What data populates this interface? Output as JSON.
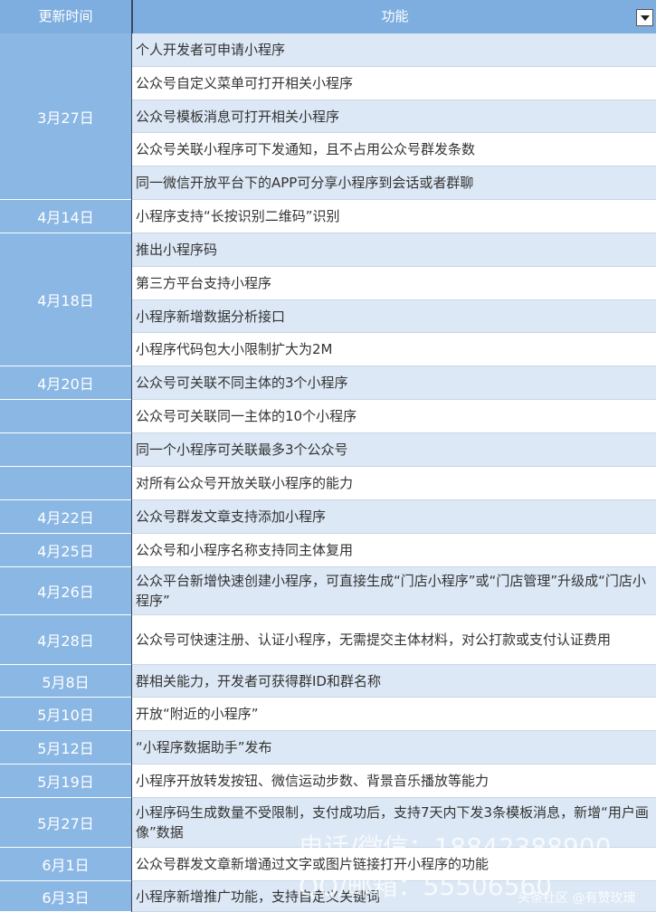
{
  "header": {
    "date_label": "更新时间",
    "function_label": "功能"
  },
  "dates": [
    {
      "label": "3月27日"
    },
    {
      "label": "4月14日"
    },
    {
      "label": "4月18日"
    },
    {
      "label": "4月20日"
    },
    {
      "label": ""
    },
    {
      "label": ""
    },
    {
      "label": ""
    },
    {
      "label": "4月22日"
    },
    {
      "label": "4月25日"
    },
    {
      "label": "4月26日"
    },
    {
      "label": "4月28日"
    },
    {
      "label": "5月8日"
    },
    {
      "label": "5月10日"
    },
    {
      "label": "5月12日"
    },
    {
      "label": "5月19日"
    },
    {
      "label": "5月27日"
    },
    {
      "label": "6月1日"
    },
    {
      "label": "6月3日"
    }
  ],
  "rows": [
    {
      "text": "个人开发者可申请小程序"
    },
    {
      "text": "公众号自定义菜单可打开相关小程序"
    },
    {
      "text": "公众号模板消息可打开相关小程序"
    },
    {
      "text": "公众号关联小程序可下发通知，且不占用公众号群发条数"
    },
    {
      "text": "同一微信开放平台下的APP可分享小程序到会话或者群聊"
    },
    {
      "text": "小程序支持“长按识别二维码”识别"
    },
    {
      "text": "推出小程序码"
    },
    {
      "text": "第三方平台支持小程序"
    },
    {
      "text": "小程序新增数据分析接口"
    },
    {
      "text": "小程序代码包大小限制扩大为2M"
    },
    {
      "text": "公众号可关联不同主体的3个小程序"
    },
    {
      "text": "公众号可关联同一主体的10个小程序"
    },
    {
      "text": "同一个小程序可关联最多3个公众号"
    },
    {
      "text": "对所有公众号开放关联小程序的能力"
    },
    {
      "text": "公众号群发文章支持添加小程序"
    },
    {
      "text": "公众号和小程序名称支持同主体复用"
    },
    {
      "text": "公众平台新增快速创建小程序，可直接生成“门店小程序”或“门店管理”升级成“门店小程序”"
    },
    {
      "text": "公众号可快速注册、认证小程序，无需提交主体材料，对公打款或支付认证费用"
    },
    {
      "text": "群相关能力，开发者可获得群ID和群名称"
    },
    {
      "text": "开放“附近的小程序”"
    },
    {
      "text": "“小程序数据助手”发布"
    },
    {
      "text": "小程序开放转发按钮、微信运动步数、背景音乐播放等能力"
    },
    {
      "text": "小程序码生成数量不受限制，支付成功后，支持7天内下发3条模板消息，新增“用户画像”数据"
    },
    {
      "text": "公众号群发文章新增通过文字或图片链接打开小程序的功能"
    },
    {
      "text": "小程序新增推广功能，支持自定义关键词"
    }
  ],
  "watermark": {
    "line1": "电话/微信：18842388900",
    "line2": "QQ/邮箱：55506560",
    "credit": "头条社区 @有赞玫瑰"
  }
}
